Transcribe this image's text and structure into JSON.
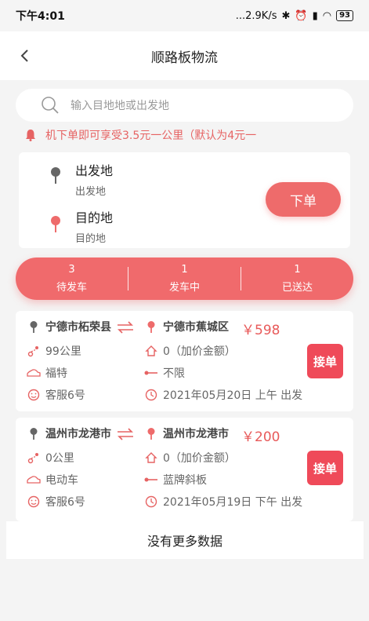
{
  "status_bar": {
    "time": "下午4:01",
    "network_speed": "...2.9K/s",
    "battery": "93"
  },
  "nav": {
    "title": "顺路板物流"
  },
  "search": {
    "placeholder": "输入目地地或出发地"
  },
  "notice": {
    "text": "机下单即可享受3.5元一公里（默认为4元一"
  },
  "route": {
    "origin_label": "出发地",
    "origin_value": "出发地",
    "destination_label": "目的地",
    "destination_value": "目的地",
    "order_button": "下单"
  },
  "stats": [
    {
      "count": "3",
      "label": "待发车"
    },
    {
      "count": "1",
      "label": "发车中"
    },
    {
      "count": "1",
      "label": "已送达"
    }
  ],
  "orders": [
    {
      "from": "宁德市柘荣县",
      "to": "宁德市蕉城区",
      "price": "￥598",
      "distance": "99公里",
      "markup": "0（加价金额）",
      "vehicle": "福特",
      "plate": "不限",
      "service": "客服6号",
      "date": "2021年05月20日 上午 出发",
      "accept": "接单"
    },
    {
      "from": "温州市龙港市",
      "to": "温州市龙港市",
      "price": "￥200",
      "distance": "0公里",
      "markup": "0（加价金额）",
      "vehicle": "电动车",
      "plate": "蓝牌斜板",
      "service": "客服6号",
      "date": "2021年05月19日 下午 出发",
      "accept": "接单"
    }
  ],
  "footer": {
    "text": "没有更多数据"
  },
  "colors": {
    "accent": "#ee6b6b",
    "accept": "#ef4a59",
    "price": "#e85a5a"
  }
}
